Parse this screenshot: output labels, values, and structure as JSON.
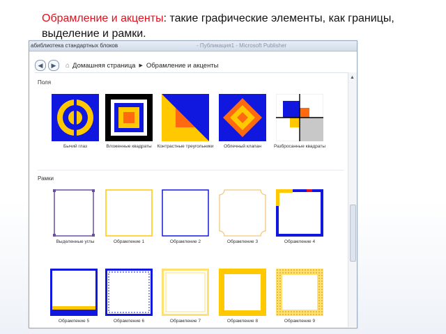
{
  "caption": {
    "accent": "Обрамление и акценты",
    "rest": ": такие графические элементы, как границы, выделение и рамки."
  },
  "window": {
    "title_left": "абиблиотека стандартных блоков",
    "title_center": "- Публикация1 - Microsoft Publisher"
  },
  "breadcrumb": {
    "home": "Домашняя страница",
    "current": "Обрамление и акценты"
  },
  "sections": {
    "fields": "Поля",
    "frames": "Рамки"
  },
  "fields": [
    {
      "label": "Бычий глаз"
    },
    {
      "label": "Вложенные квадраты"
    },
    {
      "label": "Контрастные треугольники"
    },
    {
      "label": "Облечный клапан"
    },
    {
      "label": "Разбросанные квадраты"
    }
  ],
  "frames_row1": [
    {
      "label": "Выделенные углы"
    },
    {
      "label": "Обрамление 1"
    },
    {
      "label": "Обрамление 2"
    },
    {
      "label": "Обрамление 3"
    },
    {
      "label": "Обрамление 4"
    }
  ],
  "frames_row2": [
    {
      "label": "Обрамление 5"
    },
    {
      "label": "Обрамление 6"
    },
    {
      "label": "Обрамление 7"
    },
    {
      "label": "Обрамление 8"
    },
    {
      "label": "Обрамление 9"
    }
  ],
  "icons": {
    "back": "back-icon",
    "forward": "forward-icon",
    "home": "home-icon",
    "separator": "chevron-right-icon"
  },
  "colors": {
    "accent_red": "#e0101e",
    "blue": "#1018e0",
    "yellow": "#ffc800",
    "orange": "#ff6a10",
    "black": "#000000",
    "grey": "#c8c8c8"
  }
}
